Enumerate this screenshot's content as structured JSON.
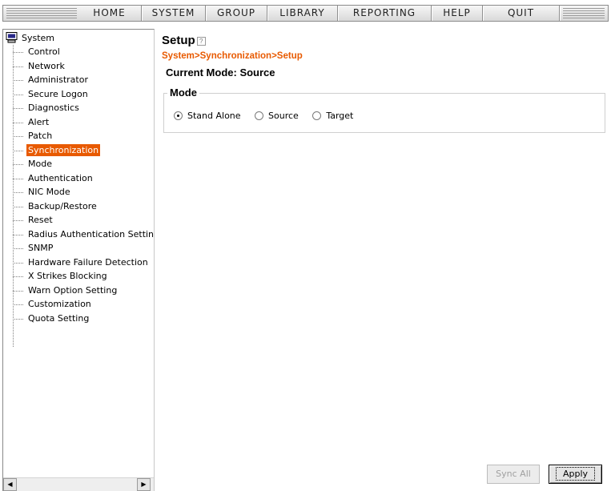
{
  "menu": {
    "items": [
      {
        "label": "HOME"
      },
      {
        "label": "SYSTEM"
      },
      {
        "label": "GROUP"
      },
      {
        "label": "LIBRARY"
      },
      {
        "label": "REPORTING"
      },
      {
        "label": "HELP"
      },
      {
        "label": "QUIT"
      }
    ]
  },
  "sidebar": {
    "root_label": "System",
    "root_icon": "monitor-icon",
    "selected": "Synchronization",
    "selected_color": "#e85a00",
    "items": [
      {
        "label": "Control"
      },
      {
        "label": "Network"
      },
      {
        "label": "Administrator"
      },
      {
        "label": "Secure Logon"
      },
      {
        "label": "Diagnostics"
      },
      {
        "label": "Alert"
      },
      {
        "label": "Patch"
      },
      {
        "label": "Synchronization"
      },
      {
        "label": "Mode"
      },
      {
        "label": "Authentication"
      },
      {
        "label": "NIC Mode"
      },
      {
        "label": "Backup/Restore"
      },
      {
        "label": "Reset"
      },
      {
        "label": "Radius Authentication Setting"
      },
      {
        "label": "SNMP"
      },
      {
        "label": "Hardware Failure Detection"
      },
      {
        "label": "X Strikes Blocking"
      },
      {
        "label": "Warn Option Setting"
      },
      {
        "label": "Customization"
      },
      {
        "label": "Quota Setting"
      }
    ],
    "scroll_left": "◀",
    "scroll_right": "▶"
  },
  "main": {
    "title": "Setup",
    "help_icon": "?",
    "breadcrumb": "System>Synchronization>Setup",
    "breadcrumb_color": "#e85a00",
    "current_mode": "Current Mode: Source",
    "mode_legend": "Mode",
    "mode_options": [
      {
        "label": "Stand Alone",
        "selected": true
      },
      {
        "label": "Source",
        "selected": false
      },
      {
        "label": "Target",
        "selected": false
      }
    ],
    "buttons": {
      "sync_all": "Sync All",
      "sync_all_enabled": false,
      "apply": "Apply"
    }
  }
}
